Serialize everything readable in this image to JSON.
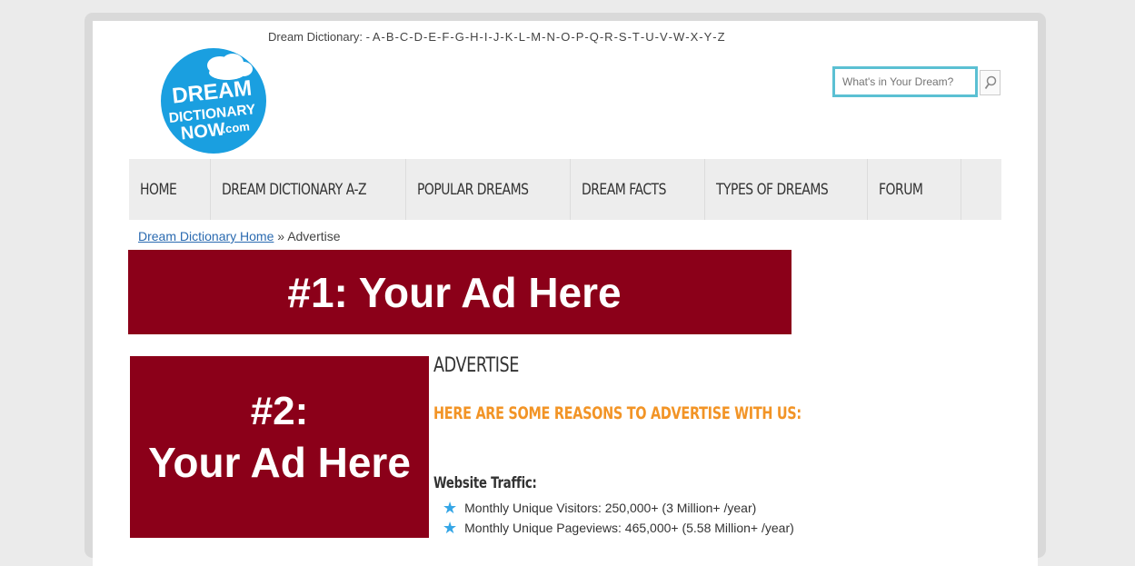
{
  "header": {
    "alpha_label": "Dream Dictionary: -",
    "letters": [
      "A",
      "B",
      "C",
      "D",
      "E",
      "F",
      "G",
      "H",
      "I",
      "J",
      "K",
      "L",
      "M",
      "N",
      "O",
      "P",
      "Q",
      "R",
      "S",
      "T",
      "U",
      "V",
      "W",
      "X",
      "Y",
      "Z"
    ]
  },
  "logo": {
    "line1": "DREAM",
    "line2": "DICTIONARY",
    "line3": "NOW",
    "line3_suffix": ".com",
    "color": "#1a9fe0"
  },
  "search": {
    "placeholder": "What's in Your Dream?",
    "icon": "search-icon"
  },
  "nav": {
    "items": [
      "HOME",
      "DREAM DICTIONARY A-Z",
      "POPULAR DREAMS",
      "DREAM FACTS",
      "TYPES OF DREAMS",
      "FORUM"
    ]
  },
  "breadcrumb": {
    "home": "Dream Dictionary Home",
    "separator": "»",
    "current": "Advertise"
  },
  "ads": {
    "ad1": "#1: Your Ad Here",
    "ad2_line1": "#2:",
    "ad2_line2": "Your Ad Here",
    "color": "#8b0019"
  },
  "content": {
    "title": "ADVERTISE",
    "subtitle": "HERE ARE SOME REASONS TO ADVERTISE WITH US:",
    "traffic_heading": "Website Traffic:",
    "stats": [
      "Monthly Unique Visitors: 250,000+ (3 Million+ /year)",
      "Monthly Unique Pageviews: 465,000+ (5.58 Million+ /year)"
    ],
    "accent": "#f29426"
  }
}
